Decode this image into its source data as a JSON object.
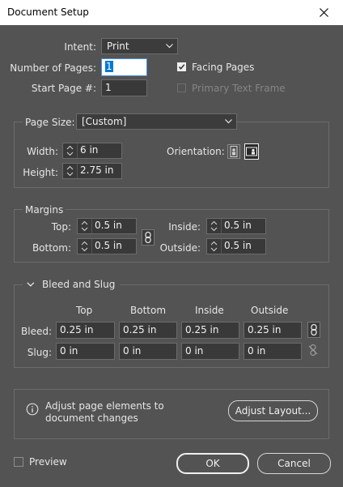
{
  "window": {
    "title": "Document Setup"
  },
  "top": {
    "intent_label": "Intent:",
    "intent_value": "Print",
    "pages_label": "Number of Pages:",
    "pages_value": "1",
    "start_label": "Start Page #:",
    "start_value": "1",
    "facing_pages_label": "Facing Pages",
    "facing_pages_checked": true,
    "primary_frame_label": "Primary Text Frame",
    "primary_frame_checked": false
  },
  "page_size": {
    "label": "Page Size:",
    "value": "[Custom]",
    "width_label": "Width:",
    "width_value": "6 in",
    "height_label": "Height:",
    "height_value": "2.75 in",
    "orientation_label": "Orientation:"
  },
  "margins": {
    "legend": "Margins",
    "top_label": "Top:",
    "top_value": "0.5 in",
    "bottom_label": "Bottom:",
    "bottom_value": "0.5 in",
    "inside_label": "Inside:",
    "inside_value": "0.5 in",
    "outside_label": "Outside:",
    "outside_value": "0.5 in"
  },
  "bleed_slug": {
    "legend": "Bleed and Slug",
    "columns": [
      "Top",
      "Bottom",
      "Inside",
      "Outside"
    ],
    "bleed_label": "Bleed:",
    "bleed_values": [
      "0.25 in",
      "0.25 in",
      "0.25 in",
      "0.25 in"
    ],
    "slug_label": "Slug:",
    "slug_values": [
      "0 in",
      "0 in",
      "0 in",
      "0 in"
    ]
  },
  "info": {
    "message": "Adjust page elements to document changes",
    "adjust_button": "Adjust Layout..."
  },
  "footer": {
    "preview_label": "Preview",
    "ok_label": "OK",
    "cancel_label": "Cancel"
  },
  "colors": {
    "background": "#535353",
    "field": "#393939",
    "border": "#6b6b6b",
    "text": "#e6e6e6"
  }
}
